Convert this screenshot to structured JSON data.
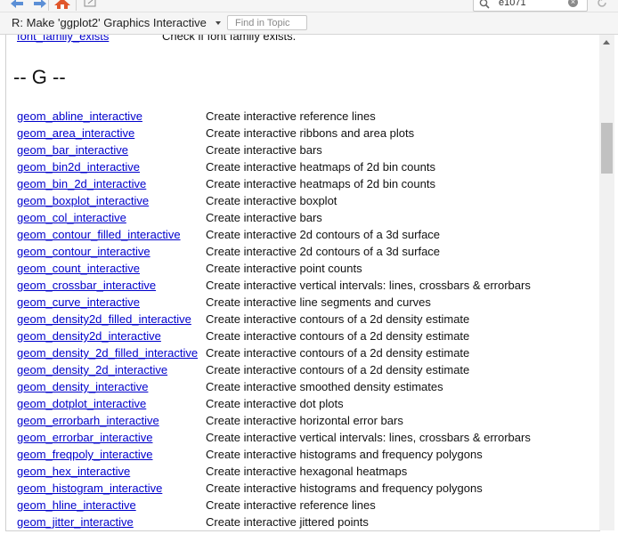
{
  "toolbar": {
    "back_icon": "arrow-left-icon",
    "forward_icon": "arrow-right-icon",
    "home_icon": "home-icon",
    "popout_icon": "popout-icon",
    "search_value": "e1071",
    "refresh_icon": "refresh-icon"
  },
  "topic_bar": {
    "title": "R: Make 'ggplot2' Graphics Interactive",
    "find_placeholder": "Find in Topic"
  },
  "content": {
    "prev_row": {
      "name": "font_family_exists",
      "description": "Check if font family exists."
    },
    "section_heading": "-- G --",
    "functions": [
      {
        "name": "geom_abline_interactive",
        "description": "Create interactive reference lines"
      },
      {
        "name": "geom_area_interactive",
        "description": "Create interactive ribbons and area plots"
      },
      {
        "name": "geom_bar_interactive",
        "description": "Create interactive bars"
      },
      {
        "name": "geom_bin2d_interactive",
        "description": "Create interactive heatmaps of 2d bin counts"
      },
      {
        "name": "geom_bin_2d_interactive",
        "description": "Create interactive heatmaps of 2d bin counts"
      },
      {
        "name": "geom_boxplot_interactive",
        "description": "Create interactive boxplot"
      },
      {
        "name": "geom_col_interactive",
        "description": "Create interactive bars"
      },
      {
        "name": "geom_contour_filled_interactive",
        "description": "Create interactive 2d contours of a 3d surface"
      },
      {
        "name": "geom_contour_interactive",
        "description": "Create interactive 2d contours of a 3d surface"
      },
      {
        "name": "geom_count_interactive",
        "description": "Create interactive point counts"
      },
      {
        "name": "geom_crossbar_interactive",
        "description": "Create interactive vertical intervals: lines, crossbars & errorbars"
      },
      {
        "name": "geom_curve_interactive",
        "description": "Create interactive line segments and curves"
      },
      {
        "name": "geom_density2d_filled_interactive",
        "description": "Create interactive contours of a 2d density estimate"
      },
      {
        "name": "geom_density2d_interactive",
        "description": "Create interactive contours of a 2d density estimate"
      },
      {
        "name": "geom_density_2d_filled_interactive",
        "description": "Create interactive contours of a 2d density estimate"
      },
      {
        "name": "geom_density_2d_interactive",
        "description": "Create interactive contours of a 2d density estimate"
      },
      {
        "name": "geom_density_interactive",
        "description": "Create interactive smoothed density estimates"
      },
      {
        "name": "geom_dotplot_interactive",
        "description": "Create interactive dot plots"
      },
      {
        "name": "geom_errorbarh_interactive",
        "description": "Create interactive horizontal error bars"
      },
      {
        "name": "geom_errorbar_interactive",
        "description": "Create interactive vertical intervals: lines, crossbars & errorbars"
      },
      {
        "name": "geom_freqpoly_interactive",
        "description": "Create interactive histograms and frequency polygons"
      },
      {
        "name": "geom_hex_interactive",
        "description": "Create interactive hexagonal heatmaps"
      },
      {
        "name": "geom_histogram_interactive",
        "description": "Create interactive histograms and frequency polygons"
      },
      {
        "name": "geom_hline_interactive",
        "description": "Create interactive reference lines"
      },
      {
        "name": "geom_jitter_interactive",
        "description": "Create interactive jittered points"
      }
    ]
  },
  "colors": {
    "link": "#0000cc",
    "text": "#111111",
    "toolbar_bg": "#f5f5f5",
    "home_icon": "#e0562b",
    "arrow_icon": "#5b8fd6"
  }
}
